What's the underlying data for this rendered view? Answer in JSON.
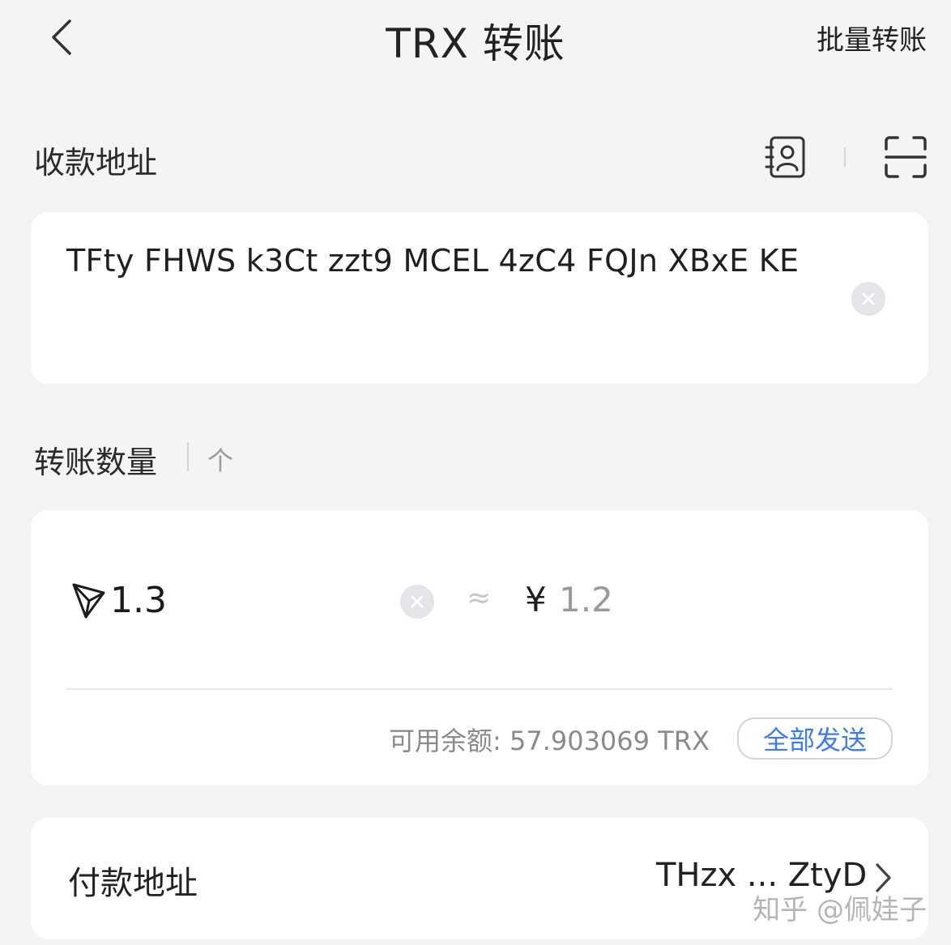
{
  "header": {
    "title": "TRX 转账",
    "batch_label": "批量转账"
  },
  "recipient": {
    "label": "收款地址",
    "address": "TFty FHWS k3Ct zzt9 MCEL 4zC4 FQJn XBxE KE"
  },
  "amount": {
    "label": "转账数量",
    "toggle_symbol": "个",
    "value": "1.3",
    "approx_symbol": "≈",
    "currency_symbol": "¥",
    "fiat_value": "1.2",
    "balance_text": "可用余额: 57.903069 TRX",
    "send_all_label": "全部发送"
  },
  "payer": {
    "label": "付款地址",
    "address": "THzx ... ZtyD"
  },
  "watermark": "知乎 @佩娃子",
  "colors": {
    "background": "#f3f4f6",
    "card": "#ffffff",
    "accent": "#3d7bf0",
    "muted": "#8a8a8d"
  },
  "icons": {
    "back": "chevron-left-icon",
    "contacts": "address-book-icon",
    "scan": "scan-icon",
    "clear": "clear-icon",
    "trx": "tron-logo-icon",
    "chevron": "chevron-right-icon"
  }
}
